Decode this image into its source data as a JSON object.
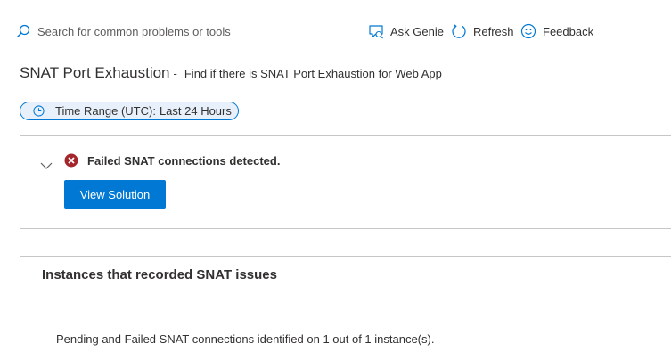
{
  "toolbar": {
    "search_placeholder": "Search for common problems or tools",
    "ask_genie": "Ask Genie",
    "refresh": "Refresh",
    "feedback": "Feedback"
  },
  "header": {
    "title": "SNAT Port Exhaustion",
    "separator": "-",
    "subtitle": "Find if there is SNAT Port Exhaustion for Web App"
  },
  "time_range": {
    "label": "Time Range (UTC):",
    "value": "Last 24 Hours"
  },
  "alert_card": {
    "message": "Failed SNAT connections detected.",
    "button_label": "View Solution"
  },
  "instances_card": {
    "title": "Instances that recorded SNAT issues",
    "body": "Pending and Failed SNAT connections identified on 1 out of 1 instance(s)."
  },
  "colors": {
    "accent": "#0078d4",
    "error": "#a4262c",
    "border": "#c8c6c4",
    "text": "#323130"
  },
  "icons": [
    "search-icon",
    "ask-genie-icon",
    "refresh-icon",
    "feedback-icon",
    "clock-icon",
    "chevron-down-icon",
    "error-icon"
  ]
}
